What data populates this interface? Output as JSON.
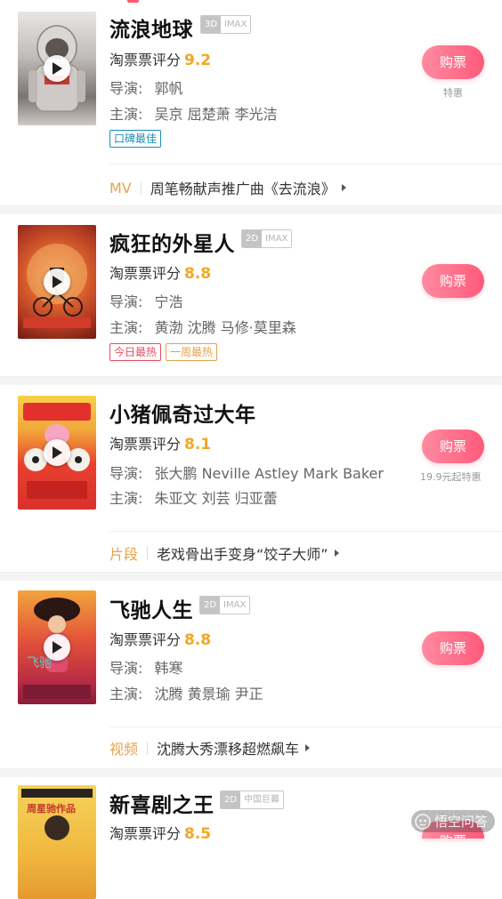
{
  "colors": {
    "accent": "#ff5b6c",
    "score": "#f5a623",
    "extra_kind": "#e8a24e"
  },
  "films": [
    {
      "title": "流浪地球",
      "formats": [
        "3D",
        "IMAX"
      ],
      "score_label": "淘票票评分",
      "score": "9.2",
      "director_label": "导演:",
      "director": "郭帆",
      "cast_label": "主演:",
      "cast": "吴京 屈楚萧 李光洁",
      "tags": [
        "口碑最佳"
      ],
      "buy_label": "购票",
      "buy_note": "特惠",
      "extra_kind": "MV",
      "extra_text": "周笔畅献声推广曲《去流浪》"
    },
    {
      "title": "疯狂的外星人",
      "formats": [
        "2D",
        "IMAX"
      ],
      "score_label": "淘票票评分",
      "score": "8.8",
      "director_label": "导演:",
      "director": "宁浩",
      "cast_label": "主演:",
      "cast": "黄渤 沈腾 马修·莫里森",
      "tags": [
        "今日最热",
        "一周最热"
      ],
      "buy_label": "购票"
    },
    {
      "title": "小猪佩奇过大年",
      "score_label": "淘票票评分",
      "score": "8.1",
      "director_label": "导演:",
      "director": "张大鹏  Neville Astley  Mark Baker",
      "cast_label": "主演:",
      "cast": "朱亚文 刘芸 归亚蕾",
      "buy_label": "购票",
      "buy_note": "19.9元起特惠",
      "extra_kind": "片段",
      "extra_text": "老戏骨出手变身“饺子大师”"
    },
    {
      "title": "飞驰人生",
      "formats": [
        "2D",
        "IMAX"
      ],
      "score_label": "淘票票评分",
      "score": "8.8",
      "director_label": "导演:",
      "director": "韩寒",
      "cast_label": "主演:",
      "cast": "沈腾 黄景瑜 尹正",
      "buy_label": "购票",
      "extra_kind": "视频",
      "extra_text": "沈腾大秀漂移超燃飙车"
    },
    {
      "title": "新喜剧之王",
      "formats": [
        "2D",
        "中国巨幕"
      ],
      "score_label": "淘票票评分",
      "score": "8.5",
      "buy_label": "购票"
    }
  ],
  "posters": {
    "p5_text": "周星驰作品"
  },
  "watermark": "悟空问答"
}
